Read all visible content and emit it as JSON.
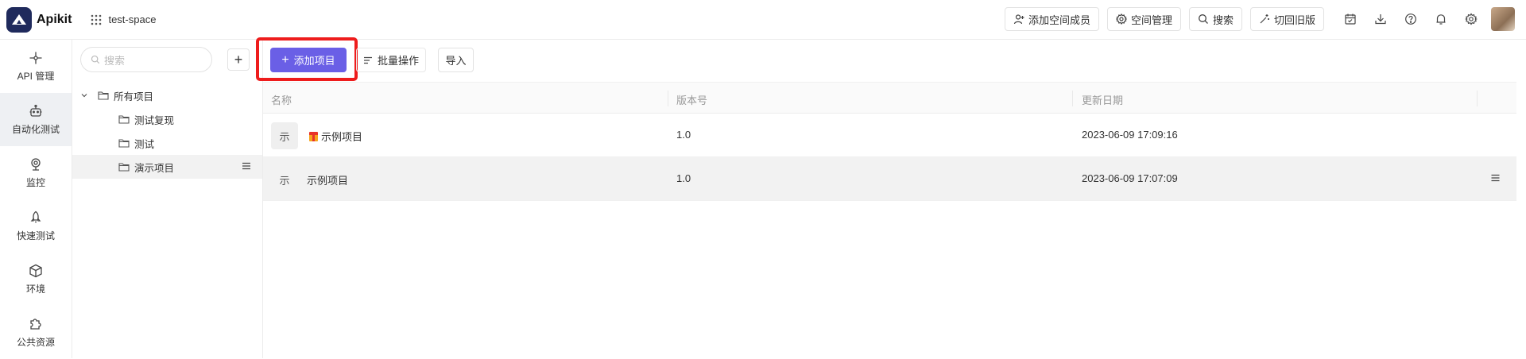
{
  "app": {
    "name": "Apikit"
  },
  "space": {
    "name": "test-space"
  },
  "topbar": {
    "add_member": "添加空间成员",
    "space_manage": "空间管理",
    "search": "搜索",
    "switch_old": "切回旧版"
  },
  "nav": [
    {
      "label": "API 管理",
      "icon": "api-icon"
    },
    {
      "label": "自动化测试",
      "icon": "robot-icon",
      "active": true
    },
    {
      "label": "监控",
      "icon": "monitor-icon"
    },
    {
      "label": "快速测试",
      "icon": "rocket-icon"
    },
    {
      "label": "环境",
      "icon": "cube-icon"
    },
    {
      "label": "公共资源",
      "icon": "puzzle-icon"
    }
  ],
  "tree": {
    "search_placeholder": "搜索",
    "root": "所有项目",
    "children": [
      "测试复现",
      "测试",
      "演示项目"
    ]
  },
  "toolbar": {
    "add_project": "添加项目",
    "batch": "批量操作",
    "import": "导入"
  },
  "table": {
    "headers": [
      "名称",
      "版本号",
      "更新日期"
    ],
    "rows": [
      {
        "badge": "示",
        "name": "示例项目",
        "version": "1.0",
        "date": "2023-06-09 17:09:16"
      },
      {
        "badge": "示",
        "name": "示例项目",
        "version": "1.0",
        "date": "2023-06-09 17:07:09"
      }
    ]
  },
  "colors": {
    "primary": "#6a5fe6",
    "logo": "#1f2a5c",
    "highlight": "#ee1c1c"
  }
}
